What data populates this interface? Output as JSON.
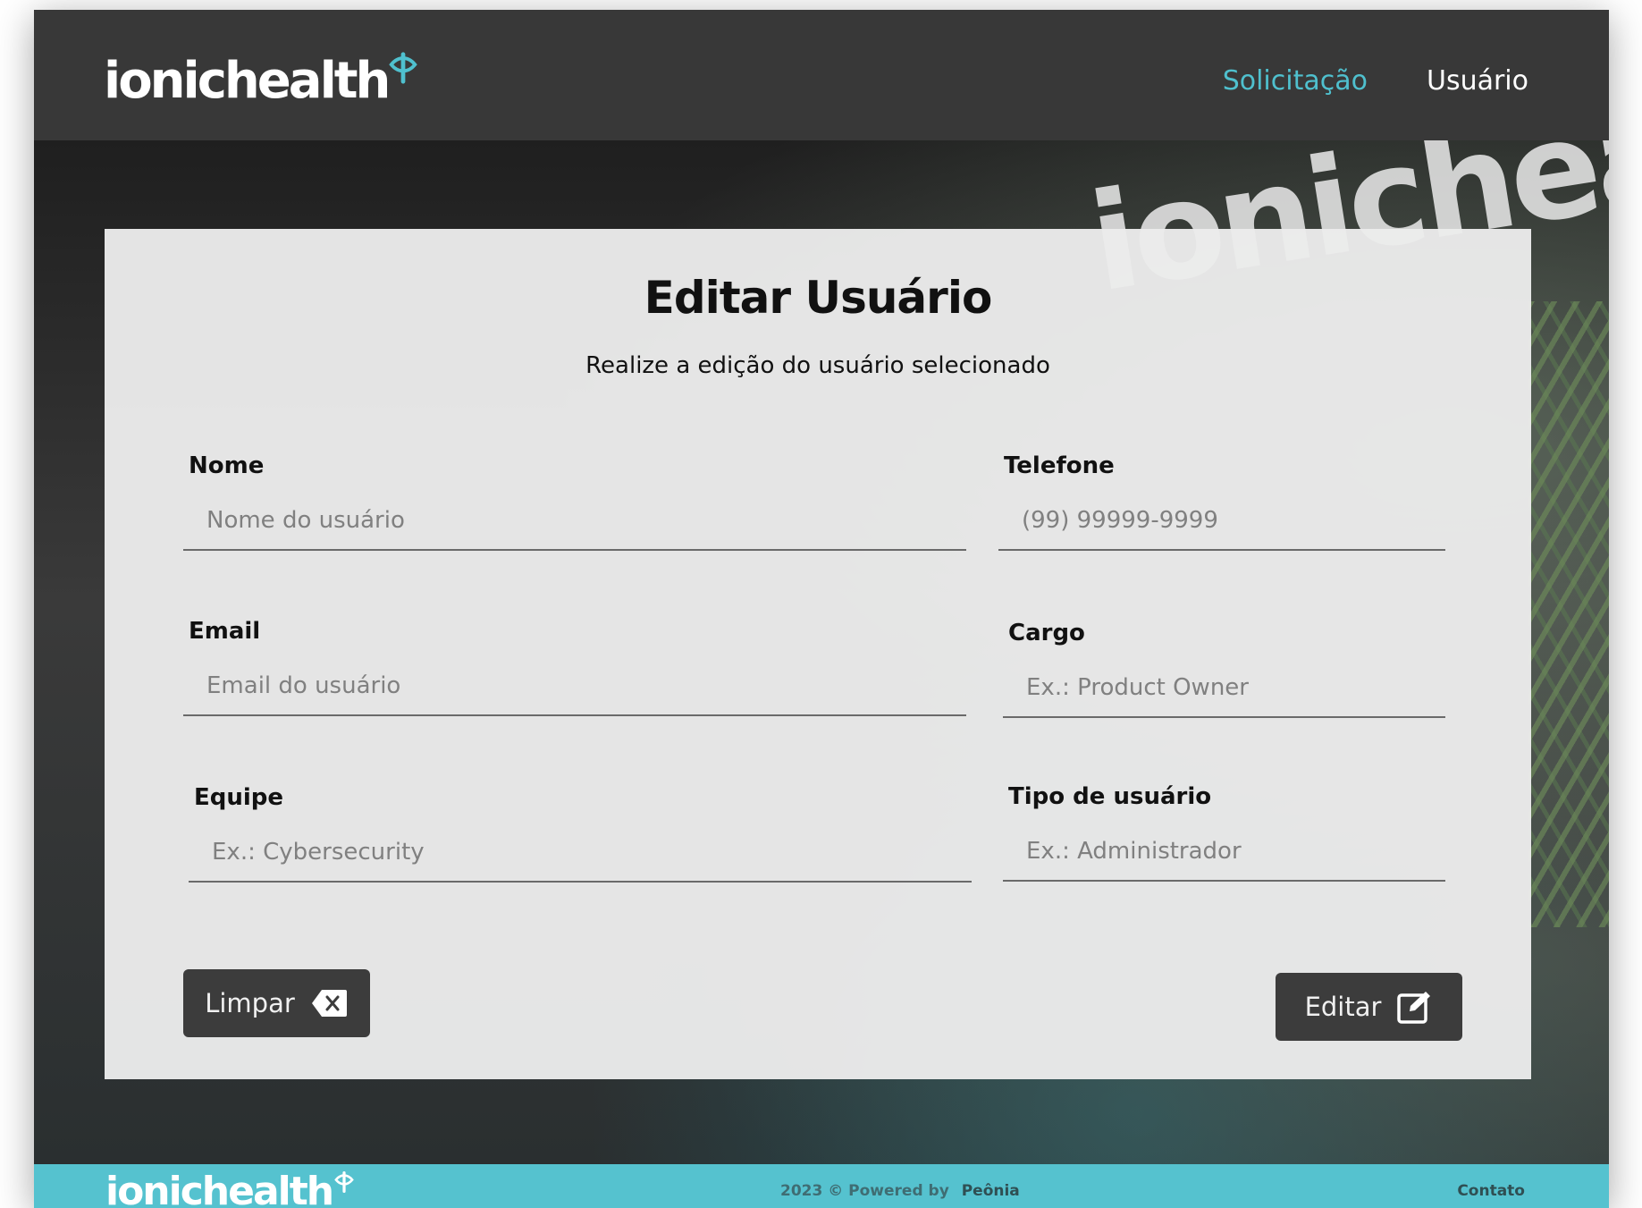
{
  "header": {
    "logo_text": "ionichealth",
    "nav": [
      {
        "label": "Solicitação",
        "active": true
      },
      {
        "label": "Usuário",
        "active": false
      }
    ]
  },
  "background": {
    "wall_text": "ionichealt"
  },
  "form": {
    "title": "Editar Usuário",
    "subtitle": "Realize a edição do usuário selecionado",
    "fields": {
      "nome": {
        "label": "Nome",
        "placeholder": "Nome do usuário",
        "value": ""
      },
      "telefone": {
        "label": "Telefone",
        "placeholder": "(99) 99999-9999",
        "value": ""
      },
      "email": {
        "label": "Email",
        "placeholder": "Email do usuário",
        "value": ""
      },
      "cargo": {
        "label": "Cargo",
        "placeholder": "Ex.: Product Owner",
        "value": ""
      },
      "equipe": {
        "label": "Equipe",
        "placeholder": "Ex.: Cybersecurity",
        "value": ""
      },
      "tipo": {
        "label": "Tipo de usuário",
        "placeholder": "Ex.: Administrador",
        "value": ""
      }
    },
    "buttons": {
      "clear_label": "Limpar",
      "clear_icon": "backspace-icon",
      "edit_label": "Editar",
      "edit_icon": "edit-square-icon"
    }
  },
  "footer": {
    "logo_text": "ionichealth",
    "copyright": "2023 © Powered by",
    "brand": "Peônia",
    "contact": "Contato"
  },
  "colors": {
    "accent": "#4fc0ce",
    "footer_bg": "#55c2cf",
    "header_bg": "#383838",
    "button_bg": "#3c3c3c"
  }
}
